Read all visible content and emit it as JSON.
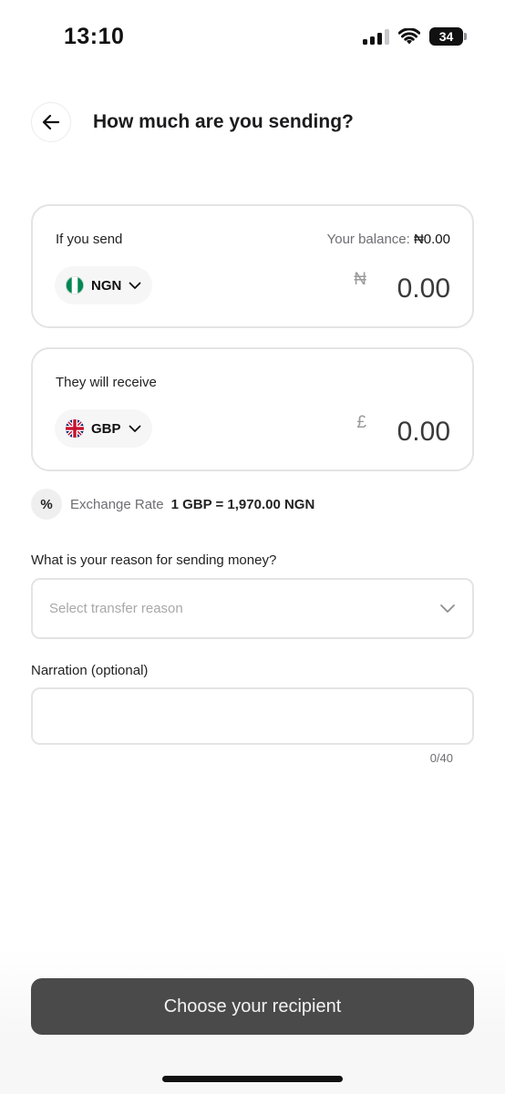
{
  "status_bar": {
    "time": "13:10",
    "battery": "34"
  },
  "header": {
    "title": "How much are you sending?"
  },
  "send_card": {
    "label": "If you send",
    "balance_label": "Your balance:",
    "balance_value": "₦0.00",
    "currency_code": "NGN",
    "currency_symbol": "₦",
    "amount": "0.00"
  },
  "receive_card": {
    "label": "They will receive",
    "currency_code": "GBP",
    "currency_symbol": "£",
    "amount": "0.00"
  },
  "exchange_rate": {
    "icon_text": "%",
    "label": "Exchange Rate",
    "value": "1 GBP = 1,970.00 NGN"
  },
  "reason": {
    "label": "What is your reason for sending money?",
    "placeholder": "Select transfer reason"
  },
  "narration": {
    "label": "Narration (optional)",
    "value": "",
    "count": "0/40"
  },
  "cta": {
    "label": "Choose your recipient"
  },
  "colors": {
    "button_bg": "#4a4a4a",
    "card_border": "#e4e4e4",
    "nigeria_green": "#008751"
  },
  "icons": [
    "back-arrow-icon",
    "nigeria-flag-icon",
    "uk-flag-icon",
    "chevron-down-icon",
    "percent-icon",
    "signal-icon",
    "wifi-icon",
    "battery-icon"
  ]
}
